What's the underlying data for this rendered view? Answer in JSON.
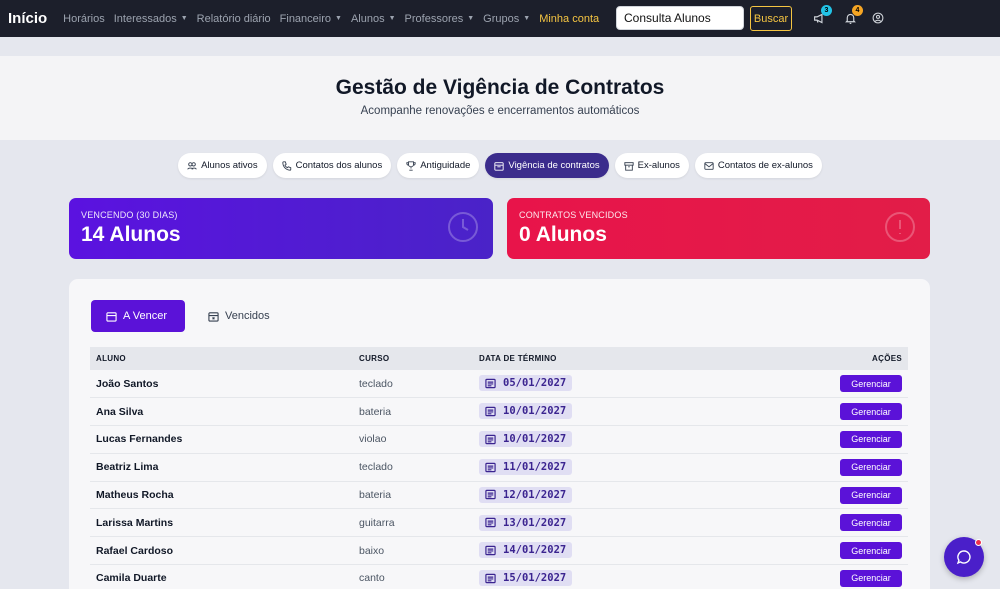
{
  "navbar": {
    "brand": "Início",
    "links": [
      {
        "label": "Horários",
        "dropdown": false
      },
      {
        "label": "Interessados",
        "dropdown": true
      },
      {
        "label": "Relatório diário",
        "dropdown": false
      },
      {
        "label": "Financeiro",
        "dropdown": true
      },
      {
        "label": "Alunos",
        "dropdown": true
      },
      {
        "label": "Professores",
        "dropdown": true
      },
      {
        "label": "Grupos",
        "dropdown": true
      },
      {
        "label": "Minha conta",
        "dropdown": false
      }
    ],
    "search_value": "Consulta Alunos",
    "search_button": "Buscar",
    "announcements_badge": "3",
    "notifications_badge": "4",
    "colors": {
      "accent": "#f5c542",
      "announce_badge": "#22c3e6",
      "notify_badge": "#f5a524"
    }
  },
  "hero": {
    "title": "Gestão de Vigência de Contratos",
    "subtitle": "Acompanhe renovações e encerramentos automáticos"
  },
  "pills": [
    {
      "label": "Alunos ativos",
      "icon": "users-icon",
      "active": false
    },
    {
      "label": "Contatos dos alunos",
      "icon": "phone-icon",
      "active": false
    },
    {
      "label": "Antiguidade",
      "icon": "trophy-icon",
      "active": false
    },
    {
      "label": "Vigência de contratos",
      "icon": "calendar-icon",
      "active": true
    },
    {
      "label": "Ex-alunos",
      "icon": "archive-icon",
      "active": false
    },
    {
      "label": "Contatos de ex-alunos",
      "icon": "envelope-icon",
      "active": false
    }
  ],
  "stats": {
    "expiring_label": "VENCENDO (30 DIAS)",
    "expiring_value": "14 Alunos",
    "expired_label": "CONTRATOS VENCIDOS",
    "expired_value": "0 Alunos"
  },
  "tabs": {
    "active": "A Vencer",
    "inactive": "Vencidos"
  },
  "table": {
    "headers": {
      "student": "ALUNO",
      "course": "CURSO",
      "end_date": "DATA DE TÉRMINO",
      "actions": "AÇÕES"
    },
    "action_label": "Gerenciar",
    "rows": [
      {
        "student": "João Santos",
        "course": "teclado",
        "end_date": "05/01/2027"
      },
      {
        "student": "Ana Silva",
        "course": "bateria",
        "end_date": "10/01/2027"
      },
      {
        "student": "Lucas Fernandes",
        "course": "violao",
        "end_date": "10/01/2027"
      },
      {
        "student": "Beatriz Lima",
        "course": "teclado",
        "end_date": "11/01/2027"
      },
      {
        "student": "Matheus Rocha",
        "course": "bateria",
        "end_date": "12/01/2027"
      },
      {
        "student": "Larissa Martins",
        "course": "guitarra",
        "end_date": "13/01/2027"
      },
      {
        "student": "Rafael Cardoso",
        "course": "baixo",
        "end_date": "14/01/2027"
      },
      {
        "student": "Camila Duarte",
        "course": "canto",
        "end_date": "15/01/2027"
      }
    ]
  }
}
